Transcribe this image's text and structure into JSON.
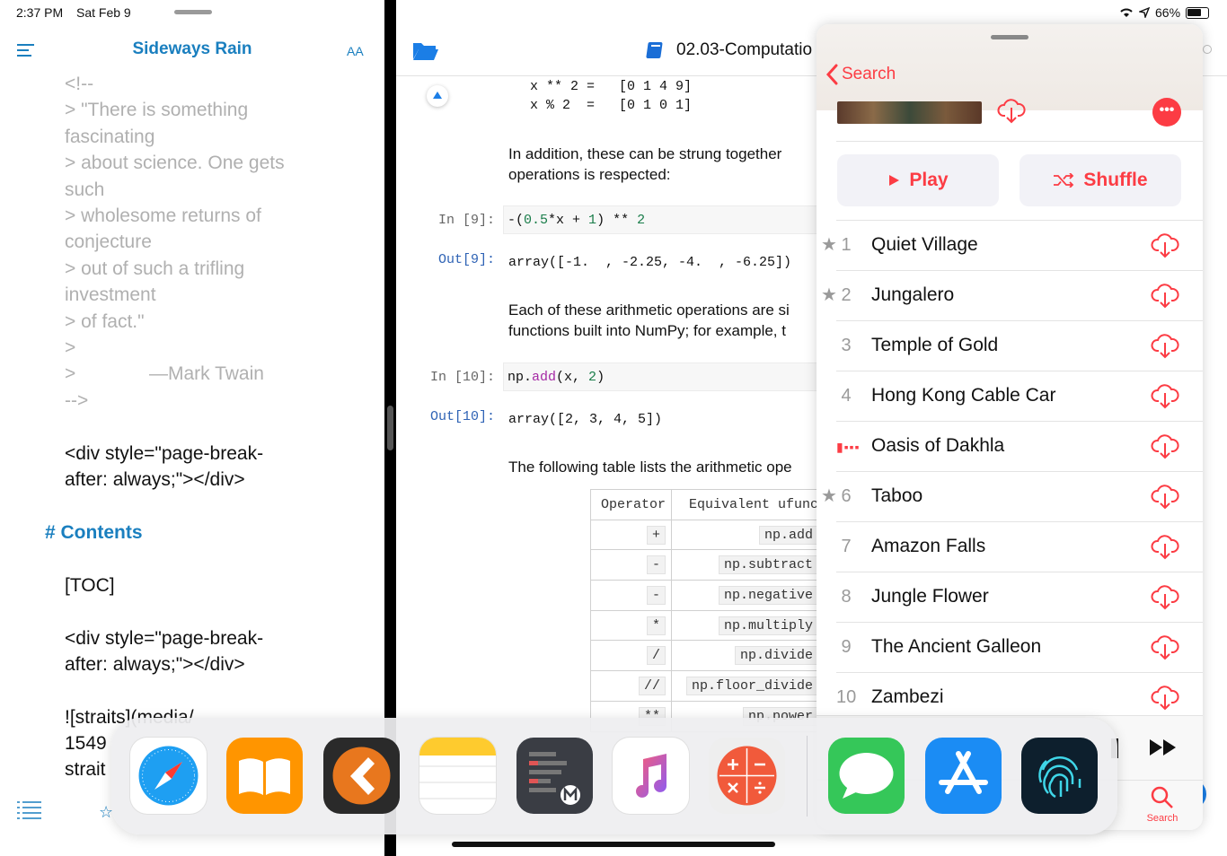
{
  "status_bar": {
    "time": "2:37 PM",
    "date": "Sat Feb 9",
    "battery": "66%"
  },
  "editor": {
    "title": "Sideways Rain",
    "font_size_label": "AA",
    "lines_muted": [
      "<!--",
      "> \"There is something",
      "fascinating",
      "> about science. One gets",
      "such",
      "> wholesome returns of",
      "conjecture",
      "> out of such a trifling",
      "investment",
      "> of fact.\"",
      ">",
      ">              —Mark Twain",
      "-->"
    ],
    "div1_line1": "<div style=\"page-break-",
    "div1_line2": "after: always;\"></div>",
    "contents_heading": "# Contents",
    "toc": "[TOC]",
    "div2_line1": "<div style=\"page-break-",
    "div2_line2": "after: always;\"></div>",
    "img_line1": "![straits](media/",
    "img_line2": "1549",
    "img_line3": "strait"
  },
  "notebook": {
    "title": "02.03-Computatio",
    "out_top_line1": "x ** 2 =   [0 1 4 9]",
    "out_top_line2": "x % 2  =   [0 1 0 1]",
    "md1_line1": "In addition, these can be strung together",
    "md1_line2": "operations is respected:",
    "in9_prompt": "In [9]:",
    "in9_code_a": "-(",
    "in9_code_b": "0.5",
    "in9_code_c": "*x + ",
    "in9_code_d": "1",
    "in9_code_e": ") ** ",
    "in9_code_f": "2",
    "out9_prompt": "Out[9]:",
    "out9_text": "array([-1.  , -2.25, -4.  , -6.25])",
    "md2_line1": "Each of these arithmetic operations are si",
    "md2_line2": "functions built into NumPy; for example, t",
    "in10_prompt": "In [10]:",
    "in10_code_a": "np.",
    "in10_code_b": "add",
    "in10_code_c": "(x, ",
    "in10_code_d": "2",
    "in10_code_e": ")",
    "out10_prompt": "Out[10]:",
    "out10_text": "array([2, 3, 4, 5])",
    "md3": "The following table lists the arithmetic ope",
    "table_headers": [
      "Operator",
      "Equivalent ufunc"
    ],
    "table_rows": [
      [
        "+",
        "np.add"
      ],
      [
        "-",
        "np.subtract"
      ],
      [
        "-",
        "np.negative"
      ],
      [
        "*",
        "np.multiply"
      ],
      [
        "/",
        "np.divide"
      ],
      [
        "//",
        "np.floor_divide"
      ],
      [
        "**",
        "np.power"
      ]
    ]
  },
  "music": {
    "back_label": "Search",
    "play_label": "Play",
    "shuffle_label": "Shuffle",
    "tracks": [
      {
        "num": "1",
        "title": "Quiet Village",
        "starred": true
      },
      {
        "num": "2",
        "title": "Jungalero",
        "starred": true
      },
      {
        "num": "3",
        "title": "Temple of Gold",
        "starred": false
      },
      {
        "num": "4",
        "title": "Hong Kong Cable Car",
        "starred": false
      },
      {
        "num": "",
        "title": "Oasis of Dakhla",
        "starred": false,
        "playing": true
      },
      {
        "num": "6",
        "title": "Taboo",
        "starred": true
      },
      {
        "num": "7",
        "title": "Amazon Falls",
        "starred": false
      },
      {
        "num": "8",
        "title": "Jungle Flower",
        "starred": false
      },
      {
        "num": "9",
        "title": "The Ancient Galleon",
        "starred": false
      },
      {
        "num": "10",
        "title": "Zambezi",
        "starred": false
      }
    ],
    "tab_search_label": "Search",
    "accent_color": "#fc3c44"
  },
  "dock": {
    "apps": [
      "safari-icon",
      "books-icon",
      "pythonista-icon",
      "notes-icon",
      "markdown-editor-icon",
      "music-icon",
      "calculator-icon",
      "messages-icon",
      "app-store-icon",
      "fingerprint-icon"
    ]
  },
  "colors": {
    "editor_accent": "#1a7fbf",
    "notebook_prompt": "#2f63b5",
    "music_red": "#fc3c44"
  }
}
